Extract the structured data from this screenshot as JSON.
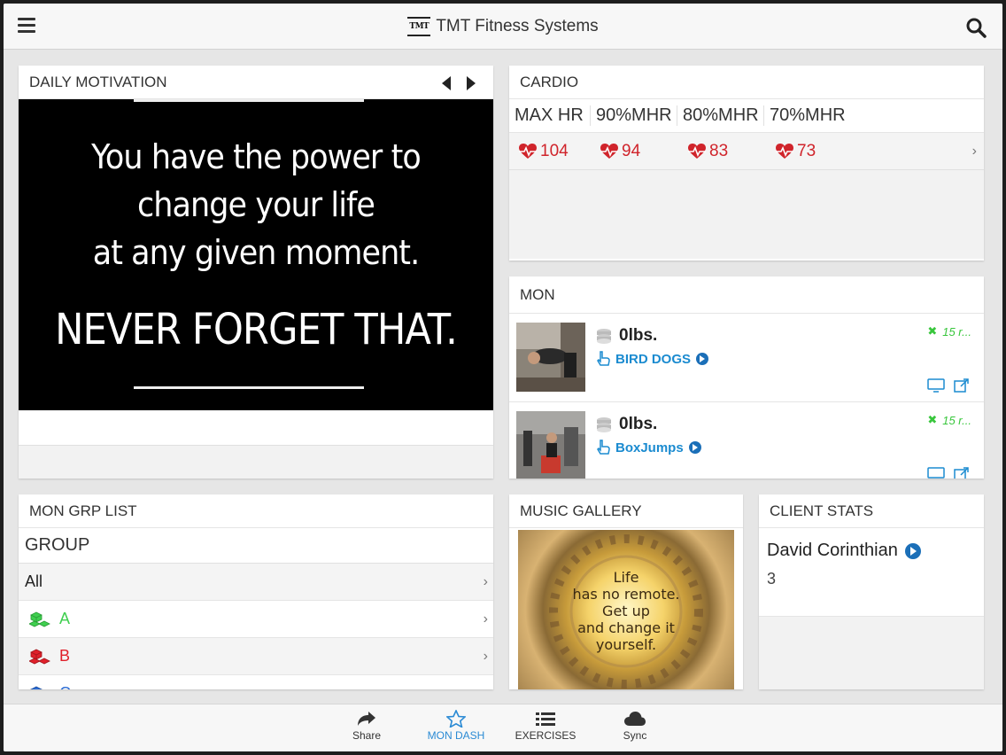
{
  "header": {
    "title": "TMT Fitness Systems",
    "logo_text": "TMT",
    "menu_icon": "hamburger-icon",
    "search_icon": "search-icon"
  },
  "motivation": {
    "title": "DAILY MOTIVATION",
    "quote_lines": [
      "You have the power to",
      "change your life",
      "at any given moment."
    ],
    "quote_caps": "NEVER FORGET THAT."
  },
  "cardio": {
    "title": "CARDIO",
    "columns": [
      "MAX HR",
      "90%MHR",
      "80%MHR",
      "70%MHR"
    ],
    "values": [
      "104",
      "94",
      "83",
      "73"
    ],
    "accent": "#d0242b"
  },
  "mon": {
    "title": "MON",
    "exercises": [
      {
        "weight": "0lbs.",
        "name": "BIRD DOGS",
        "reps": "15 r..."
      },
      {
        "weight": "0lbs.",
        "name": "BoxJumps",
        "reps": "15 r..."
      }
    ]
  },
  "group_list": {
    "title": "MON GRP LIST",
    "group_label": "GROUP",
    "rows": [
      {
        "label": "All",
        "color": "#222222"
      },
      {
        "label": "A",
        "color": "#3fcf4f"
      },
      {
        "label": "B",
        "color": "#e0202a"
      },
      {
        "label": "C",
        "color": "#2a6bd4"
      }
    ]
  },
  "music": {
    "title": "MUSIC GALLERY",
    "image_text": [
      "Life",
      "has no remote.",
      "Get up",
      "and change it",
      "yourself."
    ]
  },
  "client": {
    "title": "CLIENT STATS",
    "name": "David Corinthian",
    "count": "3"
  },
  "tabs": [
    {
      "label": "Share",
      "icon": "share-icon"
    },
    {
      "label": "MON DASH",
      "icon": "star-icon"
    },
    {
      "label": "EXERCISES",
      "icon": "list-icon"
    },
    {
      "label": "Sync",
      "icon": "cloud-icon"
    }
  ]
}
